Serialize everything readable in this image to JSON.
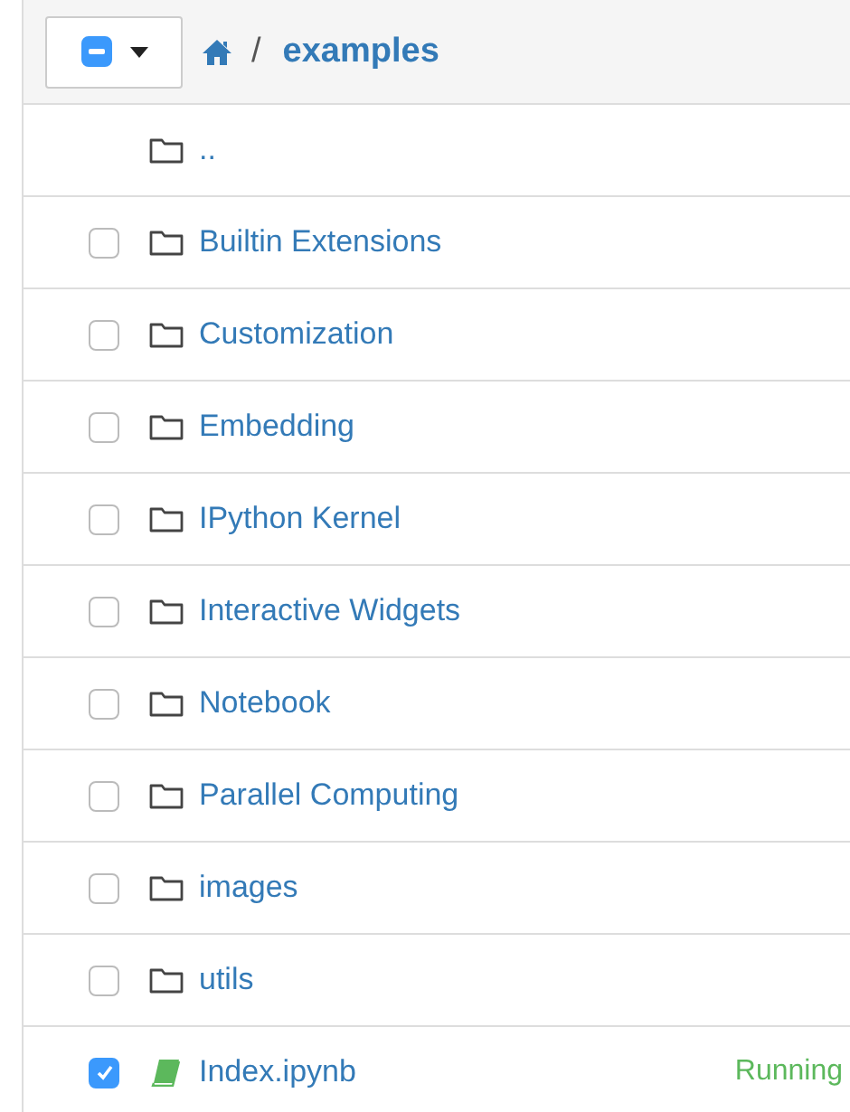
{
  "toolbar": {
    "select_all_indeterminate": true,
    "breadcrumb": "/",
    "folder": "examples"
  },
  "items": [
    {
      "kind": "parent",
      "name": ".."
    },
    {
      "kind": "folder",
      "name": "Builtin Extensions",
      "checked": false
    },
    {
      "kind": "folder",
      "name": "Customization",
      "checked": false
    },
    {
      "kind": "folder",
      "name": "Embedding",
      "checked": false
    },
    {
      "kind": "folder",
      "name": "IPython Kernel",
      "checked": false
    },
    {
      "kind": "folder",
      "name": "Interactive Widgets",
      "checked": false
    },
    {
      "kind": "folder",
      "name": "Notebook",
      "checked": false
    },
    {
      "kind": "folder",
      "name": "Parallel Computing",
      "checked": false
    },
    {
      "kind": "folder",
      "name": "images",
      "checked": false
    },
    {
      "kind": "folder",
      "name": "utils",
      "checked": false
    },
    {
      "kind": "notebook",
      "name": "Index.ipynb",
      "checked": true,
      "status": "Running"
    }
  ]
}
